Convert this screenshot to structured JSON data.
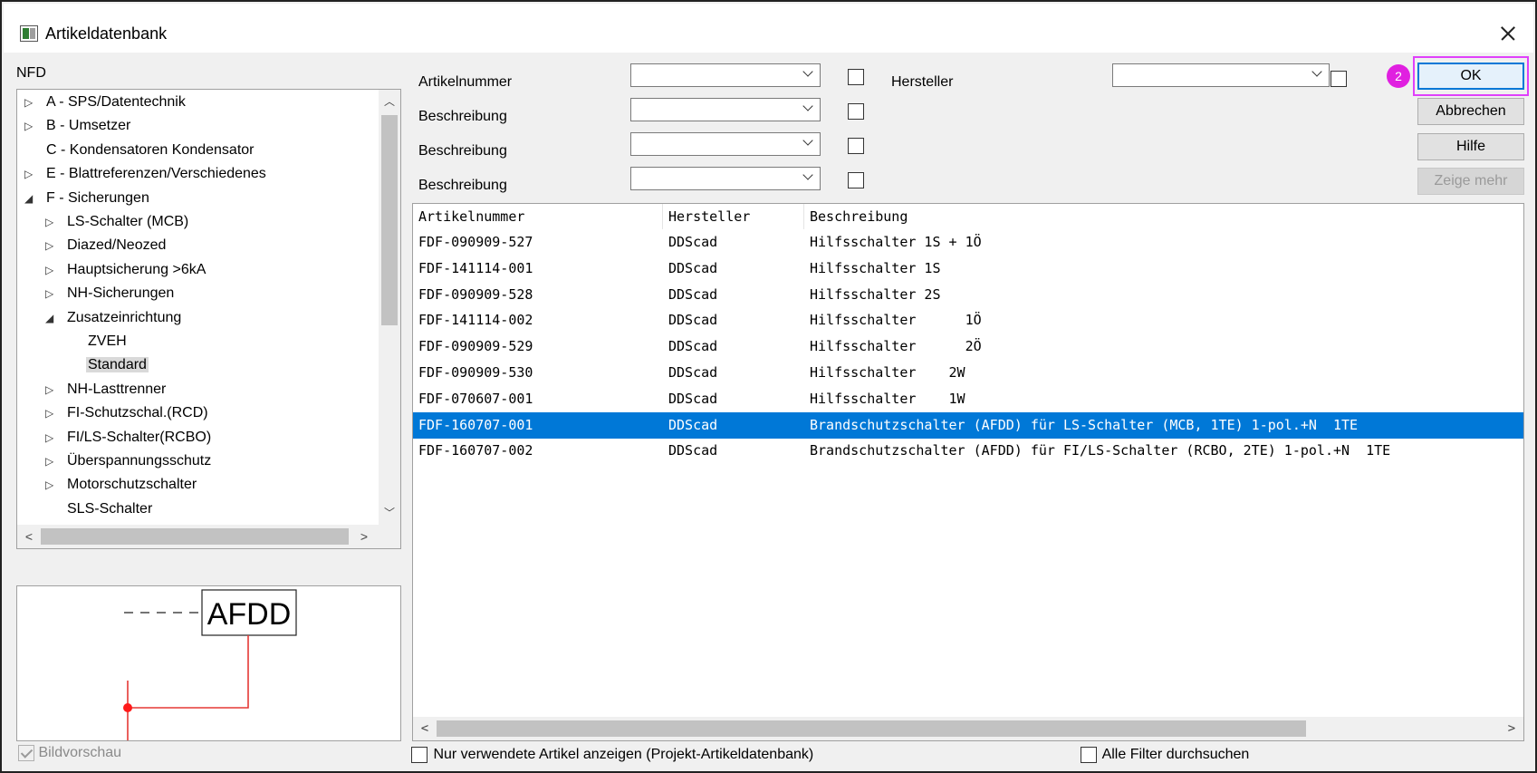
{
  "window": {
    "title": "Artikeldatenbank"
  },
  "tree": {
    "label": "NFD",
    "items": [
      {
        "label": "A - SPS/Datentechnik",
        "expander": "▷",
        "level": 0
      },
      {
        "label": "B - Umsetzer",
        "expander": "▷",
        "level": 0
      },
      {
        "label": "C - Kondensatoren Kondensator",
        "expander": "",
        "level": 0
      },
      {
        "label": "E - Blattreferenzen/Verschiedenes",
        "expander": "▷",
        "level": 0
      },
      {
        "label": "F - Sicherungen",
        "expander": "◢",
        "level": 0
      },
      {
        "label": "LS-Schalter (MCB)",
        "expander": "▷",
        "level": 1
      },
      {
        "label": "Diazed/Neozed",
        "expander": "▷",
        "level": 1
      },
      {
        "label": "Hauptsicherung >6kA",
        "expander": "▷",
        "level": 1
      },
      {
        "label": "NH-Sicherungen",
        "expander": "▷",
        "level": 1
      },
      {
        "label": "Zusatzeinrichtung",
        "expander": "◢",
        "level": 1
      },
      {
        "label": "ZVEH",
        "expander": "",
        "level": 2
      },
      {
        "label": "Standard",
        "expander": "",
        "level": 2,
        "selected": true
      },
      {
        "label": "NH-Lasttrenner",
        "expander": "▷",
        "level": 1
      },
      {
        "label": "FI-Schutzschal.(RCD)",
        "expander": "▷",
        "level": 1
      },
      {
        "label": "FI/LS-Schalter(RCBO)",
        "expander": "▷",
        "level": 1
      },
      {
        "label": "Überspannungsschutz",
        "expander": "▷",
        "level": 1
      },
      {
        "label": "Motorschutzschalter",
        "expander": "▷",
        "level": 1
      },
      {
        "label": "SLS-Schalter",
        "expander": "",
        "level": 1
      }
    ]
  },
  "preview": {
    "symbol_text": "AFDD"
  },
  "bildvorschau": {
    "label": "Bildvorschau",
    "checked": true
  },
  "filters": {
    "artikelnummer": {
      "label": "Artikelnummer",
      "value": ""
    },
    "beschreibung1": {
      "label": "Beschreibung",
      "value": ""
    },
    "beschreibung2": {
      "label": "Beschreibung",
      "value": ""
    },
    "beschreibung3": {
      "label": "Beschreibung",
      "value": ""
    },
    "hersteller": {
      "label": "Hersteller",
      "value": ""
    }
  },
  "buttons": {
    "ok": "OK",
    "abbrechen": "Abbrechen",
    "hilfe": "Hilfe",
    "zeige_mehr": "Zeige mehr"
  },
  "badge": "2",
  "table": {
    "columns": [
      "Artikelnummer",
      "Hersteller",
      "Beschreibung"
    ],
    "rows": [
      {
        "artikelnummer": "FDF-090909-527",
        "hersteller": "DDScad",
        "beschreibung": "Hilfsschalter 1S + 1Ö"
      },
      {
        "artikelnummer": "FDF-141114-001",
        "hersteller": "DDScad",
        "beschreibung": "Hilfsschalter 1S"
      },
      {
        "artikelnummer": "FDF-090909-528",
        "hersteller": "DDScad",
        "beschreibung": "Hilfsschalter 2S"
      },
      {
        "artikelnummer": "FDF-141114-002",
        "hersteller": "DDScad",
        "beschreibung": "Hilfsschalter      1Ö"
      },
      {
        "artikelnummer": "FDF-090909-529",
        "hersteller": "DDScad",
        "beschreibung": "Hilfsschalter      2Ö"
      },
      {
        "artikelnummer": "FDF-090909-530",
        "hersteller": "DDScad",
        "beschreibung": "Hilfsschalter    2W"
      },
      {
        "artikelnummer": "FDF-070607-001",
        "hersteller": "DDScad",
        "beschreibung": "Hilfsschalter    1W"
      },
      {
        "artikelnummer": "FDF-160707-001",
        "hersteller": "DDScad",
        "beschreibung": "Brandschutzschalter (AFDD) für LS-Schalter (MCB, 1TE) 1-pol.+N  1TE",
        "selected": true
      },
      {
        "artikelnummer": "FDF-160707-002",
        "hersteller": "DDScad",
        "beschreibung": "Brandschutzschalter (AFDD) für FI/LS-Schalter (RCBO, 2TE) 1-pol.+N  1TE"
      }
    ]
  },
  "bottom": {
    "nur_verwendete": "Nur verwendete Artikel anzeigen (Projekt-Artikeldatenbank)",
    "alle_filter": "Alle Filter durchsuchen"
  },
  "colors": {
    "selection": "#0078d7",
    "highlight": "#e040fb",
    "badge": "#e020e0",
    "symbol_wire": "#e53935"
  }
}
